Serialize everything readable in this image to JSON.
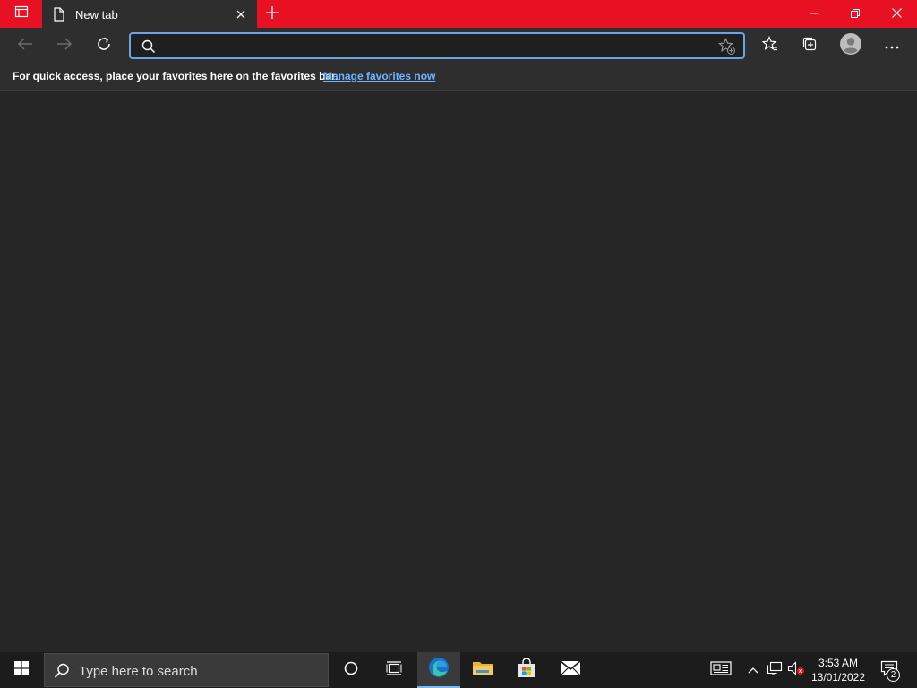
{
  "browser": {
    "tab_title": "New tab",
    "address_placeholder": "",
    "address_value": "",
    "favorites_bar_message": "For quick access, place your favorites here on the favorites bar.",
    "favorites_bar_link": "Manage favorites now"
  },
  "taskbar": {
    "search_placeholder": "Type here to search",
    "clock_time": "3:53 AM",
    "clock_date": "13/01/2022",
    "notification_count": "2"
  },
  "colors": {
    "titlebar": "#e81123",
    "toolbar": "#2e2e2e",
    "content": "#262626",
    "taskbar": "#1c1c1c",
    "link": "#6fb3ff",
    "address_border": "#6aa4e0"
  }
}
